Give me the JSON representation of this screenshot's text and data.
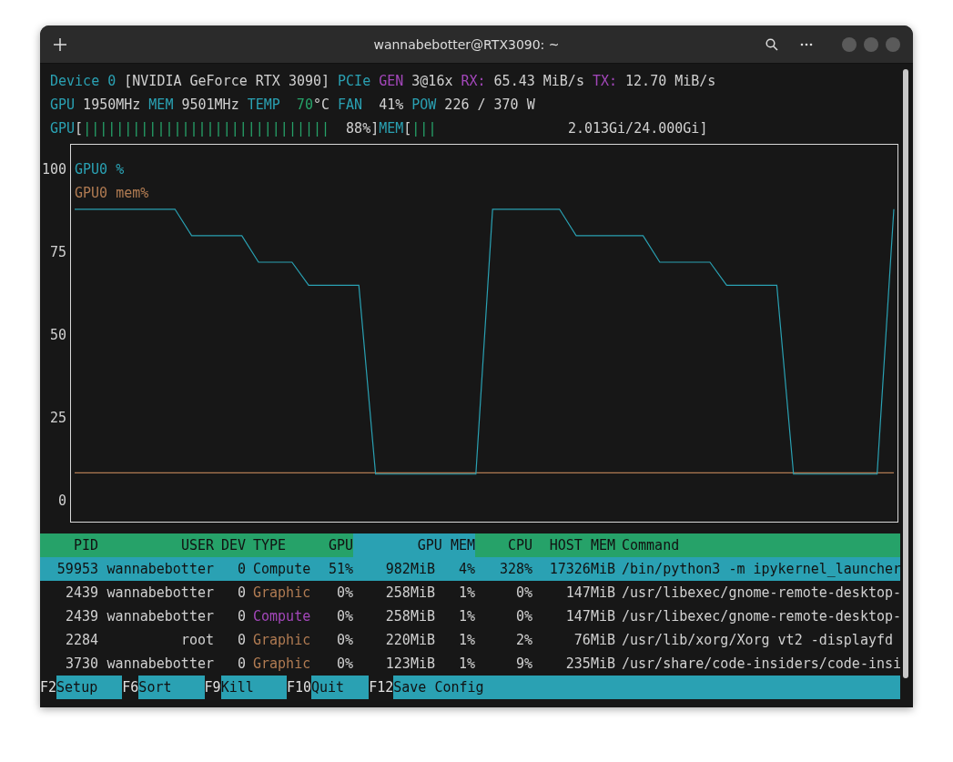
{
  "window": {
    "title": "wannabebotter@RTX3090: ~"
  },
  "info_lines": [
    [
      {
        "text": "Device 0",
        "kind": "label"
      },
      {
        "text": "[NVIDIA GeForce RTX 3090]",
        "kind": "value"
      },
      {
        "text": "PCIe",
        "kind": "label"
      },
      {
        "text": "GEN",
        "kind": "accent"
      },
      {
        "text": "3@16x",
        "kind": "value"
      },
      {
        "text": "RX:",
        "kind": "accent"
      },
      {
        "text": "65.43 MiB/s",
        "kind": "value"
      },
      {
        "text": "TX:",
        "kind": "accent"
      },
      {
        "text": "12.70 MiB/s",
        "kind": "value"
      }
    ],
    [
      {
        "text": "GPU",
        "kind": "label"
      },
      {
        "text": "1950MHz",
        "kind": "value"
      },
      {
        "text": "MEM",
        "kind": "label"
      },
      {
        "text": "9501MHz",
        "kind": "value"
      },
      {
        "text": "TEMP",
        "kind": "label"
      },
      {
        "text": "70",
        "kind": "good",
        "wide": true,
        "unit": "°C"
      },
      {
        "text": "FAN",
        "kind": "label"
      },
      {
        "text": "41%",
        "kind": "value",
        "wide": true
      },
      {
        "text": "POW",
        "kind": "label"
      },
      {
        "text": "226 / 370 W",
        "kind": "value"
      }
    ]
  ],
  "meters": [
    {
      "label": "GPU",
      "open": "[",
      "bars": "||||||||||||||||||||||||||||||",
      "reading": "88%",
      "close": "]"
    },
    {
      "label": "MEM",
      "open": "[",
      "bars": "|||",
      "reading": "2.013Gi/24.000Gi",
      "close": "]"
    }
  ],
  "chart": {
    "chart_data": {
      "type": "line",
      "ylim": [
        -6.5,
        107.6
      ],
      "yticks": [
        0,
        25,
        50,
        75,
        100
      ],
      "series": [
        {
          "name": "GPU0 %",
          "color": "#2aa1b3",
          "values": [
            88,
            88,
            88,
            88,
            88,
            88,
            88,
            80,
            80,
            80,
            80,
            72,
            72,
            72,
            65,
            65,
            65,
            65,
            8,
            8,
            8,
            8,
            8,
            8,
            8,
            88,
            88,
            88,
            88,
            88,
            80,
            80,
            80,
            80,
            80,
            72,
            72,
            72,
            72,
            65,
            65,
            65,
            65,
            8,
            8,
            8,
            8,
            8,
            8,
            88
          ]
        },
        {
          "name": "GPU0 mem%",
          "color": "#b07b52",
          "values": [
            8.4,
            8.4,
            8.4,
            8.4,
            8.4,
            8.4,
            8.4,
            8.4,
            8.4,
            8.4,
            8.4,
            8.4,
            8.4,
            8.4,
            8.4,
            8.4,
            8.4,
            8.4,
            8.4,
            8.4,
            8.4,
            8.4,
            8.4,
            8.4,
            8.4,
            8.4,
            8.4,
            8.4,
            8.4,
            8.4,
            8.4,
            8.4,
            8.4,
            8.4,
            8.4,
            8.4,
            8.4,
            8.4,
            8.4,
            8.4,
            8.4,
            8.4,
            8.4,
            8.4,
            8.4,
            8.4,
            8.4,
            8.4,
            8.4,
            8.4
          ]
        }
      ]
    }
  },
  "table": {
    "columns": [
      {
        "label": "PID",
        "sorted": false
      },
      {
        "label": "USER",
        "sorted": false
      },
      {
        "label": "DEV",
        "sorted": false
      },
      {
        "label": "TYPE",
        "sorted": false
      },
      {
        "label": "GPU",
        "sorted": false
      },
      {
        "label": "GPU MEM",
        "sorted": true
      },
      {
        "label": "CPU",
        "sorted": false
      },
      {
        "label": "HOST MEM",
        "sorted": false
      },
      {
        "label": "Command",
        "sorted": false
      }
    ],
    "rows": [
      {
        "selected": true,
        "pid": "59953",
        "user": "wannabebotter",
        "dev": "0",
        "type": "Compute",
        "kind": "compute",
        "gpu": "51%",
        "gpu_mem": "982MiB",
        "mem_pct": "4%",
        "cpu": "328%",
        "host_mem": "17326MiB",
        "command": "/bin/python3 -m ipykernel_launcher"
      },
      {
        "selected": false,
        "pid": "2439",
        "user": "wannabebotter",
        "dev": "0",
        "type": "Graphic",
        "kind": "graphic",
        "gpu": "0%",
        "gpu_mem": "258MiB",
        "mem_pct": "1%",
        "cpu": "0%",
        "host_mem": "147MiB",
        "command": "/usr/libexec/gnome-remote-desktop-"
      },
      {
        "selected": false,
        "pid": "2439",
        "user": "wannabebotter",
        "dev": "0",
        "type": "Compute",
        "kind": "compute",
        "gpu": "0%",
        "gpu_mem": "258MiB",
        "mem_pct": "1%",
        "cpu": "0%",
        "host_mem": "147MiB",
        "command": "/usr/libexec/gnome-remote-desktop-"
      },
      {
        "selected": false,
        "pid": "2284",
        "user": "root",
        "dev": "0",
        "type": "Graphic",
        "kind": "graphic",
        "gpu": "0%",
        "gpu_mem": "220MiB",
        "mem_pct": "1%",
        "cpu": "2%",
        "host_mem": "76MiB",
        "command": "/usr/lib/xorg/Xorg vt2 -displayfd"
      },
      {
        "selected": false,
        "pid": "3730",
        "user": "wannabebotter",
        "dev": "0",
        "type": "Graphic",
        "kind": "graphic",
        "gpu": "0%",
        "gpu_mem": "123MiB",
        "mem_pct": "1%",
        "cpu": "9%",
        "host_mem": "235MiB",
        "command": "/usr/share/code-insiders/code-insi"
      }
    ]
  },
  "function_keys": [
    {
      "key": "F2",
      "label": "Setup"
    },
    {
      "key": "F6",
      "label": "Sort"
    },
    {
      "key": "F9",
      "label": "Kill"
    },
    {
      "key": "F10",
      "label": "Quit"
    },
    {
      "key": "F12",
      "label": "Save Config"
    }
  ]
}
